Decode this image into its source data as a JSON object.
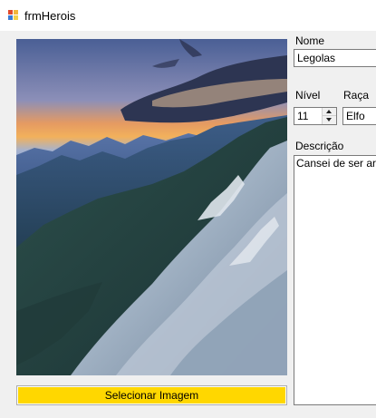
{
  "window": {
    "title": "frmHerois",
    "icon": "winforms-app-icon"
  },
  "picture": {
    "description_icon": "mountain-landscape-image"
  },
  "buttons": {
    "select_image": "Selecionar Imagem"
  },
  "form": {
    "name_label": "Nome",
    "name_value": "Legolas",
    "level_label": "Nível",
    "level_value": "11",
    "race_label": "Raça",
    "race_value": "Elfo",
    "description_label": "Descrição",
    "description_value": "Cansei de ser arque"
  },
  "colors": {
    "button_background": "#ffd700",
    "window_background": "#f0f0f0"
  }
}
